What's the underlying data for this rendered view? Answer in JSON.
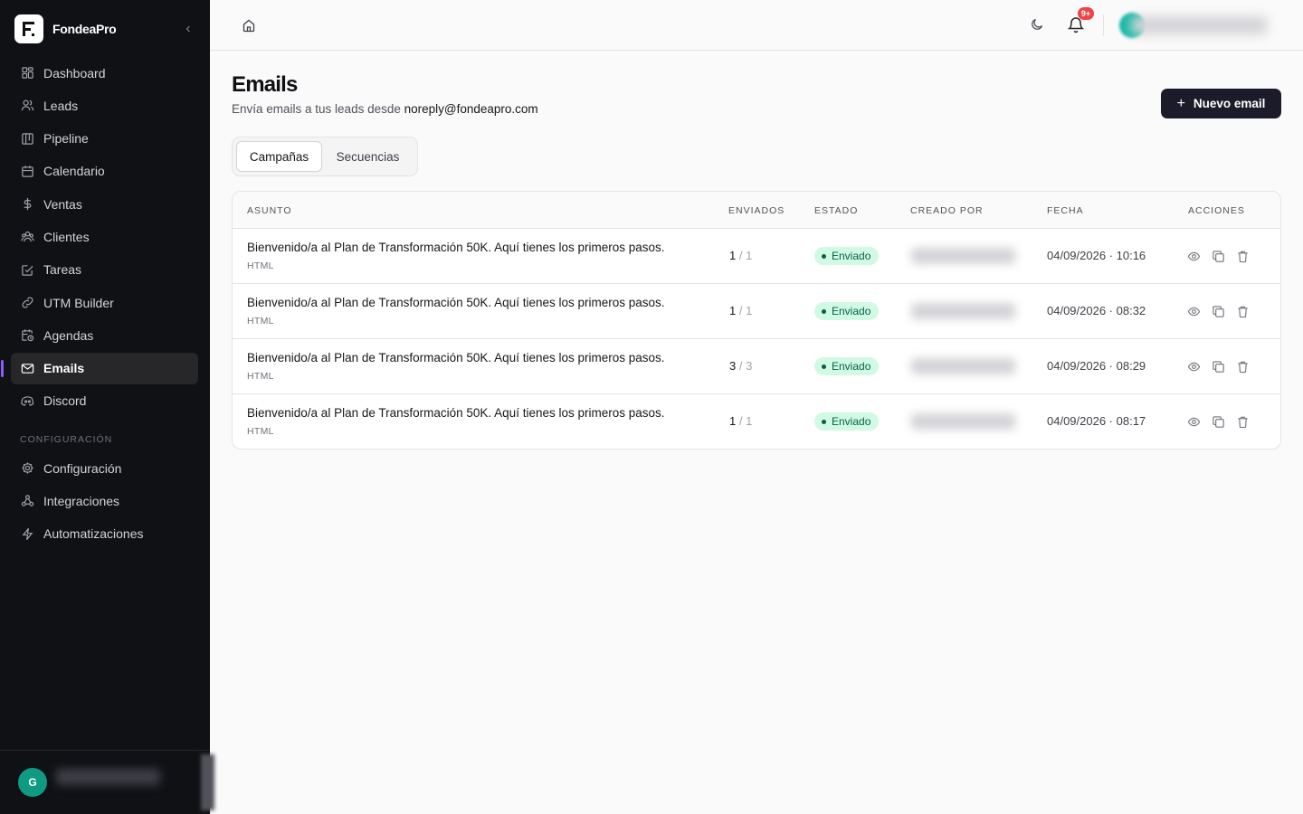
{
  "sidebar": {
    "brand": "FondeaPro",
    "nav": [
      {
        "label": "Dashboard",
        "icon": "dashboard-icon"
      },
      {
        "label": "Leads",
        "icon": "users-icon"
      },
      {
        "label": "Pipeline",
        "icon": "pipeline-icon"
      },
      {
        "label": "Calendario",
        "icon": "calendar-icon"
      },
      {
        "label": "Ventas",
        "icon": "dollar-icon"
      },
      {
        "label": "Clientes",
        "icon": "clients-icon"
      },
      {
        "label": "Tareas",
        "icon": "tasks-icon"
      },
      {
        "label": "UTM Builder",
        "icon": "link-icon"
      },
      {
        "label": "Agendas",
        "icon": "calendar-clock-icon"
      },
      {
        "label": "Emails",
        "icon": "mail-icon",
        "active": true
      },
      {
        "label": "Discord",
        "icon": "discord-icon"
      }
    ],
    "section_label": "CONFIGURACIÓN",
    "config_nav": [
      {
        "label": "Configuración",
        "icon": "gear-icon"
      },
      {
        "label": "Integraciones",
        "icon": "webhook-icon"
      },
      {
        "label": "Automatizaciones",
        "icon": "zap-icon"
      }
    ],
    "user_initial": "G"
  },
  "topbar": {
    "notification_count": "9+"
  },
  "page": {
    "title": "Emails",
    "subtitle_prefix": "Envía emails a tus leads desde ",
    "subtitle_email": "noreply@fondeapro.com",
    "new_button": "Nuevo email",
    "tabs": [
      "Campañas",
      "Secuencias"
    ],
    "active_tab": "Campañas"
  },
  "table": {
    "headers": [
      "ASUNTO",
      "ENVIADOS",
      "ESTADO",
      "CREADO POR",
      "FECHA",
      "ACCIONES"
    ],
    "rows": [
      {
        "subject": "Bienvenido/a al Plan de Transformación 50K. Aquí tienes los primeros pasos.",
        "format": "HTML",
        "sent": "1",
        "total": "1",
        "status": "Enviado",
        "date": "04/09/2026 · 10:16"
      },
      {
        "subject": "Bienvenido/a al Plan de Transformación 50K. Aquí tienes los primeros pasos.",
        "format": "HTML",
        "sent": "1",
        "total": "1",
        "status": "Enviado",
        "date": "04/09/2026 · 08:32"
      },
      {
        "subject": "Bienvenido/a al Plan de Transformación 50K. Aquí tienes los primeros pasos.",
        "format": "HTML",
        "sent": "3",
        "total": "3",
        "status": "Enviado",
        "date": "04/09/2026 · 08:29"
      },
      {
        "subject": "Bienvenido/a al Plan de Transformación 50K. Aquí tienes los primeros pasos.",
        "format": "HTML",
        "sent": "1",
        "total": "1",
        "status": "Enviado",
        "date": "04/09/2026 · 08:17"
      }
    ]
  },
  "colors": {
    "sidebar_bg": "#0f1115",
    "accent": "#8b5cf6",
    "primary_button": "#1c1b29",
    "status_bg": "#d1fae5",
    "status_text": "#065f46",
    "badge": "#ef4444"
  }
}
